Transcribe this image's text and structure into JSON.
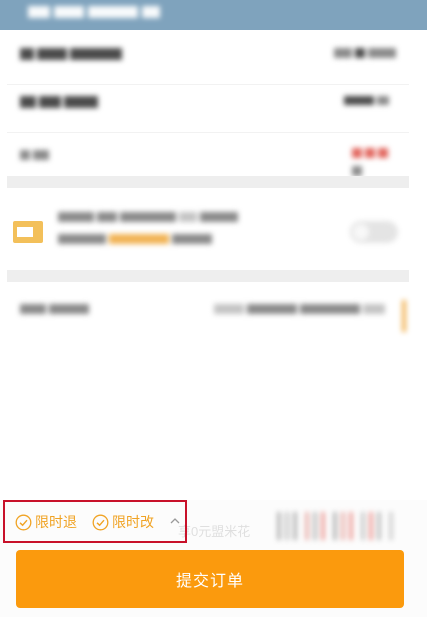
{
  "policy": {
    "limited_refund_label": "限时退",
    "limited_change_label": "限时改",
    "promo_text": "享0元盟米花"
  },
  "submit_button": {
    "label": "提交订单"
  },
  "colors": {
    "accent": "#fb9a0d",
    "policy_text": "#f0a324",
    "highlight_border": "#c8112a",
    "header": "#7fa3bd"
  }
}
